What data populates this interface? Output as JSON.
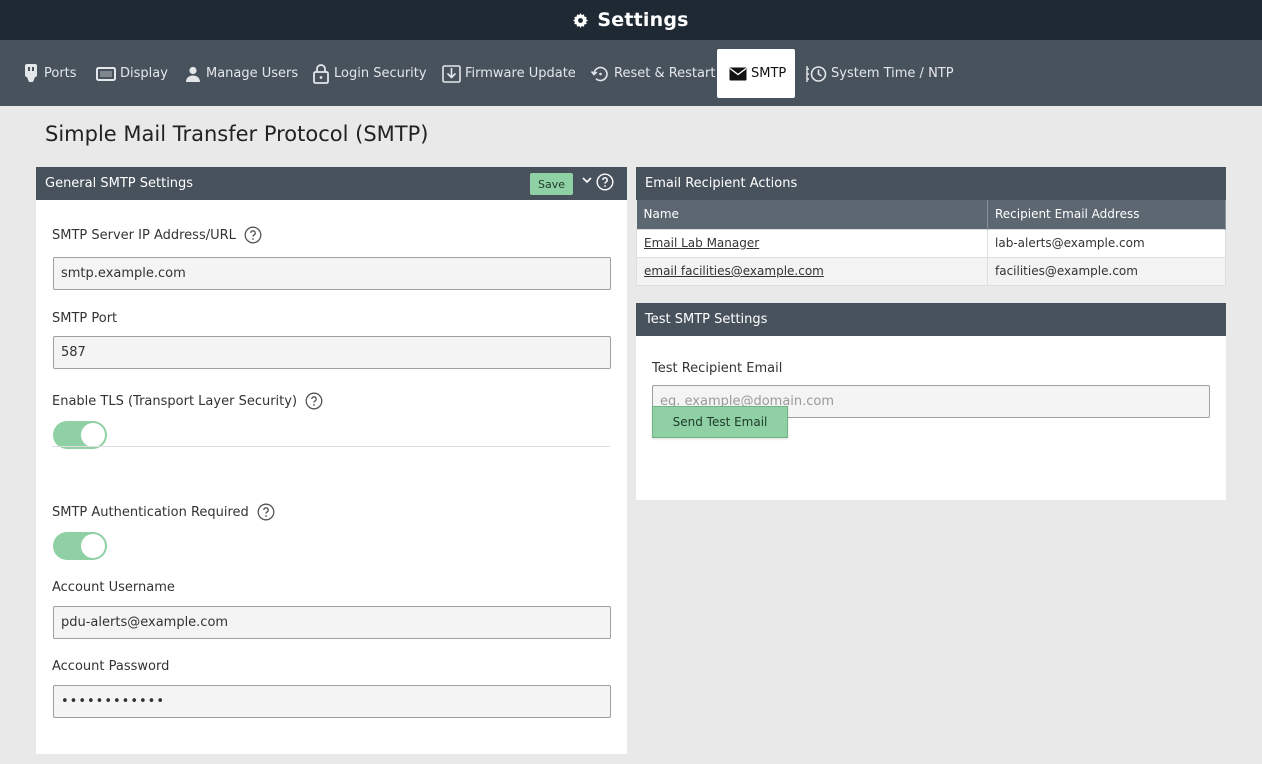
{
  "header": {
    "title": "Settings",
    "icon": "gear-icon"
  },
  "nav": {
    "items": [
      {
        "label": "Ports",
        "icon": "usb-plug-icon"
      },
      {
        "label": "Display",
        "icon": "display-icon"
      },
      {
        "label": "Manage Users",
        "icon": "user-icon"
      },
      {
        "label": "Login Security",
        "icon": "lock-icon"
      },
      {
        "label": "Firmware Update",
        "icon": "download-icon"
      },
      {
        "label": "Reset & Restart",
        "icon": "restart-icon"
      },
      {
        "label": "SMTP",
        "icon": "envelope-icon",
        "active": true
      },
      {
        "label": "System Time / NTP",
        "icon": "clock-icon"
      }
    ]
  },
  "page": {
    "title": "Simple Mail Transfer Protocol (SMTP)"
  },
  "general": {
    "title": "General SMTP Settings",
    "save_label": "Save",
    "server_label": "SMTP Server IP Address/URL",
    "server_value": "smtp.example.com",
    "port_label": "SMTP Port",
    "port_value": "587",
    "tls_label": "Enable TLS (Transport Layer Security)",
    "tls_enabled": true,
    "auth_label": "SMTP Authentication Required",
    "auth_enabled": true,
    "username_label": "Account Username",
    "username_value": "pdu-alerts@example.com",
    "password_label": "Account Password",
    "password_value": "••••••••••••"
  },
  "recipients": {
    "title": "Email Recipient Actions",
    "columns": [
      "Name",
      "Recipient Email Address"
    ],
    "rows": [
      {
        "name": "Email Lab Manager",
        "email": "lab-alerts@example.com"
      },
      {
        "name": "email facilities@example.com",
        "email": "facilities@example.com"
      }
    ]
  },
  "test": {
    "title": "Test SMTP Settings",
    "recipient_label": "Test Recipient Email",
    "recipient_placeholder": "eg. example@domain.com",
    "send_label": "Send Test Email"
  },
  "colors": {
    "header_bg": "#1f2933",
    "nav_bg": "#47525d",
    "accent_green": "#8fd0a4",
    "page_bg": "#e9e9e9"
  }
}
